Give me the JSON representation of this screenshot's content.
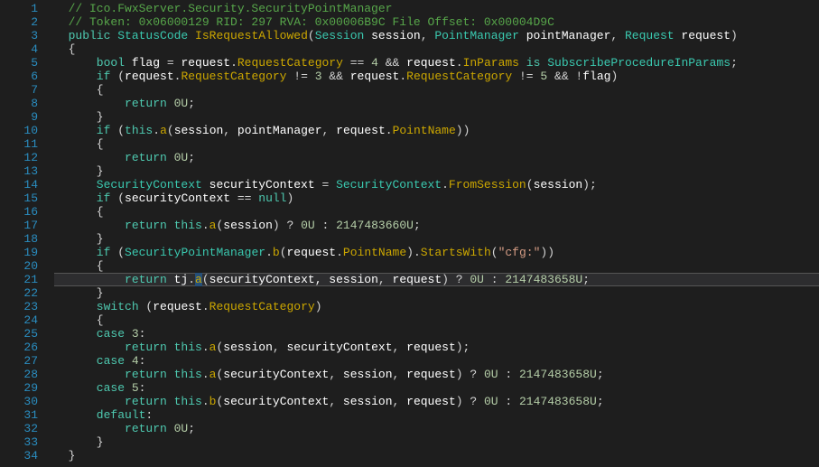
{
  "lines": [
    {
      "n": 1,
      "tokens": [
        [
          "cm",
          "  // Ico.FwxServer.Security.SecurityPointManager"
        ]
      ]
    },
    {
      "n": 2,
      "tokens": [
        [
          "cm",
          "  // Token: 0x06000129 RID: 297 RVA: 0x00006B9C File Offset: 0x00004D9C"
        ]
      ]
    },
    {
      "n": 3,
      "tokens": [
        [
          "kw",
          "  public "
        ],
        [
          "ty",
          "StatusCode "
        ],
        [
          "mtd",
          "IsRequestAllowed"
        ],
        [
          "op",
          "("
        ],
        [
          "ty",
          "Session "
        ],
        [
          "pl",
          "session"
        ],
        [
          "op",
          ", "
        ],
        [
          "ty",
          "PointManager "
        ],
        [
          "pl",
          "pointManager"
        ],
        [
          "op",
          ", "
        ],
        [
          "ty",
          "Request "
        ],
        [
          "pl",
          "request"
        ],
        [
          "op",
          ")"
        ]
      ]
    },
    {
      "n": 4,
      "tokens": [
        [
          "op",
          "  {"
        ]
      ]
    },
    {
      "n": 5,
      "tokens": [
        [
          "kw",
          "      bool "
        ],
        [
          "pl",
          "flag"
        ],
        [
          "op",
          " = "
        ],
        [
          "pl",
          "request"
        ],
        [
          "op",
          "."
        ],
        [
          "prop",
          "RequestCategory"
        ],
        [
          "op",
          " == "
        ],
        [
          "num",
          "4"
        ],
        [
          "op",
          " && "
        ],
        [
          "pl",
          "request"
        ],
        [
          "op",
          "."
        ],
        [
          "prop",
          "InParams"
        ],
        [
          "kw",
          " is "
        ],
        [
          "ty",
          "SubscribeProcedureInParams"
        ],
        [
          "op",
          ";"
        ]
      ]
    },
    {
      "n": 6,
      "tokens": [
        [
          "kw",
          "      if "
        ],
        [
          "op",
          "("
        ],
        [
          "pl",
          "request"
        ],
        [
          "op",
          "."
        ],
        [
          "prop",
          "RequestCategory"
        ],
        [
          "op",
          " != "
        ],
        [
          "num",
          "3"
        ],
        [
          "op",
          " && "
        ],
        [
          "pl",
          "request"
        ],
        [
          "op",
          "."
        ],
        [
          "prop",
          "RequestCategory"
        ],
        [
          "op",
          " != "
        ],
        [
          "num",
          "5"
        ],
        [
          "op",
          " && !"
        ],
        [
          "pl",
          "flag"
        ],
        [
          "op",
          ")"
        ]
      ]
    },
    {
      "n": 7,
      "tokens": [
        [
          "op",
          "      {"
        ]
      ]
    },
    {
      "n": 8,
      "tokens": [
        [
          "kw",
          "          return "
        ],
        [
          "num",
          "0U"
        ],
        [
          "op",
          ";"
        ]
      ]
    },
    {
      "n": 9,
      "tokens": [
        [
          "op",
          "      }"
        ]
      ]
    },
    {
      "n": 10,
      "tokens": [
        [
          "kw",
          "      if "
        ],
        [
          "op",
          "("
        ],
        [
          "kw",
          "this"
        ],
        [
          "op",
          "."
        ],
        [
          "mtd",
          "a"
        ],
        [
          "op",
          "("
        ],
        [
          "pl",
          "session"
        ],
        [
          "op",
          ", "
        ],
        [
          "pl",
          "pointManager"
        ],
        [
          "op",
          ", "
        ],
        [
          "pl",
          "request"
        ],
        [
          "op",
          "."
        ],
        [
          "prop",
          "PointName"
        ],
        [
          "op",
          "))"
        ]
      ]
    },
    {
      "n": 11,
      "tokens": [
        [
          "op",
          "      {"
        ]
      ]
    },
    {
      "n": 12,
      "tokens": [
        [
          "kw",
          "          return "
        ],
        [
          "num",
          "0U"
        ],
        [
          "op",
          ";"
        ]
      ]
    },
    {
      "n": 13,
      "tokens": [
        [
          "op",
          "      }"
        ]
      ]
    },
    {
      "n": 14,
      "tokens": [
        [
          "ty",
          "      SecurityContext "
        ],
        [
          "pl",
          "securityContext"
        ],
        [
          "op",
          " = "
        ],
        [
          "ty",
          "SecurityContext"
        ],
        [
          "op",
          "."
        ],
        [
          "mtd",
          "FromSession"
        ],
        [
          "op",
          "("
        ],
        [
          "pl",
          "session"
        ],
        [
          "op",
          ");"
        ]
      ]
    },
    {
      "n": 15,
      "tokens": [
        [
          "kw",
          "      if "
        ],
        [
          "op",
          "("
        ],
        [
          "pl",
          "securityContext"
        ],
        [
          "op",
          " == "
        ],
        [
          "kw",
          "null"
        ],
        [
          "op",
          ")"
        ]
      ]
    },
    {
      "n": 16,
      "tokens": [
        [
          "op",
          "      {"
        ]
      ]
    },
    {
      "n": 17,
      "tokens": [
        [
          "kw",
          "          return "
        ],
        [
          "kw",
          "this"
        ],
        [
          "op",
          "."
        ],
        [
          "mtd",
          "a"
        ],
        [
          "op",
          "("
        ],
        [
          "pl",
          "session"
        ],
        [
          "op",
          ") ? "
        ],
        [
          "num",
          "0U"
        ],
        [
          "op",
          " : "
        ],
        [
          "num",
          "2147483660U"
        ],
        [
          "op",
          ";"
        ]
      ]
    },
    {
      "n": 18,
      "tokens": [
        [
          "op",
          "      }"
        ]
      ]
    },
    {
      "n": 19,
      "tokens": [
        [
          "kw",
          "      if "
        ],
        [
          "op",
          "("
        ],
        [
          "ty",
          "SecurityPointManager"
        ],
        [
          "op",
          "."
        ],
        [
          "mtd",
          "b"
        ],
        [
          "op",
          "("
        ],
        [
          "pl",
          "request"
        ],
        [
          "op",
          "."
        ],
        [
          "prop",
          "PointName"
        ],
        [
          "op",
          ")."
        ],
        [
          "mtd",
          "StartsWith"
        ],
        [
          "op",
          "("
        ],
        [
          "str",
          "\"cfg:\""
        ],
        [
          "op",
          "))"
        ]
      ]
    },
    {
      "n": 20,
      "tokens": [
        [
          "op",
          "      {"
        ]
      ]
    },
    {
      "n": 21,
      "tokens": [
        [
          "kw",
          "          return "
        ],
        [
          "pl",
          "tj"
        ],
        [
          "op",
          "."
        ],
        [
          "mtd",
          "a"
        ],
        [
          "op",
          "("
        ],
        [
          "pl",
          "securityContext, "
        ],
        [
          "pl",
          "session"
        ],
        [
          "op",
          ", "
        ],
        [
          "pl",
          "request"
        ],
        [
          "op",
          ") ? "
        ],
        [
          "num",
          "0U"
        ],
        [
          "op",
          " : "
        ],
        [
          "num",
          "2147483658U"
        ],
        [
          "op",
          ";"
        ]
      ],
      "highlight": true,
      "selCol": 20
    },
    {
      "n": 22,
      "tokens": [
        [
          "op",
          "      }"
        ]
      ]
    },
    {
      "n": 23,
      "tokens": [
        [
          "kw",
          "      switch "
        ],
        [
          "op",
          "("
        ],
        [
          "pl",
          "request"
        ],
        [
          "op",
          "."
        ],
        [
          "prop",
          "RequestCategory"
        ],
        [
          "op",
          ")"
        ]
      ]
    },
    {
      "n": 24,
      "tokens": [
        [
          "op",
          "      {"
        ]
      ]
    },
    {
      "n": 25,
      "tokens": [
        [
          "kw",
          "      case "
        ],
        [
          "num",
          "3"
        ],
        [
          "op",
          ":"
        ]
      ]
    },
    {
      "n": 26,
      "tokens": [
        [
          "kw",
          "          return "
        ],
        [
          "kw",
          "this"
        ],
        [
          "op",
          "."
        ],
        [
          "mtd",
          "a"
        ],
        [
          "op",
          "("
        ],
        [
          "pl",
          "session"
        ],
        [
          "op",
          ", "
        ],
        [
          "pl",
          "securityContext"
        ],
        [
          "op",
          ", "
        ],
        [
          "pl",
          "request"
        ],
        [
          "op",
          ");"
        ]
      ]
    },
    {
      "n": 27,
      "tokens": [
        [
          "kw",
          "      case "
        ],
        [
          "num",
          "4"
        ],
        [
          "op",
          ":"
        ]
      ]
    },
    {
      "n": 28,
      "tokens": [
        [
          "kw",
          "          return "
        ],
        [
          "kw",
          "this"
        ],
        [
          "op",
          "."
        ],
        [
          "mtd",
          "a"
        ],
        [
          "op",
          "("
        ],
        [
          "pl",
          "securityContext"
        ],
        [
          "op",
          ", "
        ],
        [
          "pl",
          "session"
        ],
        [
          "op",
          ", "
        ],
        [
          "pl",
          "request"
        ],
        [
          "op",
          ") ? "
        ],
        [
          "num",
          "0U"
        ],
        [
          "op",
          " : "
        ],
        [
          "num",
          "2147483658U"
        ],
        [
          "op",
          ";"
        ]
      ]
    },
    {
      "n": 29,
      "tokens": [
        [
          "kw",
          "      case "
        ],
        [
          "num",
          "5"
        ],
        [
          "op",
          ":"
        ]
      ]
    },
    {
      "n": 30,
      "tokens": [
        [
          "kw",
          "          return "
        ],
        [
          "kw",
          "this"
        ],
        [
          "op",
          "."
        ],
        [
          "mtd",
          "b"
        ],
        [
          "op",
          "("
        ],
        [
          "pl",
          "securityContext"
        ],
        [
          "op",
          ", "
        ],
        [
          "pl",
          "session"
        ],
        [
          "op",
          ", "
        ],
        [
          "pl",
          "request"
        ],
        [
          "op",
          ") ? "
        ],
        [
          "num",
          "0U"
        ],
        [
          "op",
          " : "
        ],
        [
          "num",
          "2147483658U"
        ],
        [
          "op",
          ";"
        ]
      ]
    },
    {
      "n": 31,
      "tokens": [
        [
          "kw",
          "      default"
        ],
        [
          "op",
          ":"
        ]
      ]
    },
    {
      "n": 32,
      "tokens": [
        [
          "kw",
          "          return "
        ],
        [
          "num",
          "0U"
        ],
        [
          "op",
          ";"
        ]
      ]
    },
    {
      "n": 33,
      "tokens": [
        [
          "op",
          "      }"
        ]
      ]
    },
    {
      "n": 34,
      "tokens": [
        [
          "op",
          "  }"
        ]
      ]
    }
  ]
}
